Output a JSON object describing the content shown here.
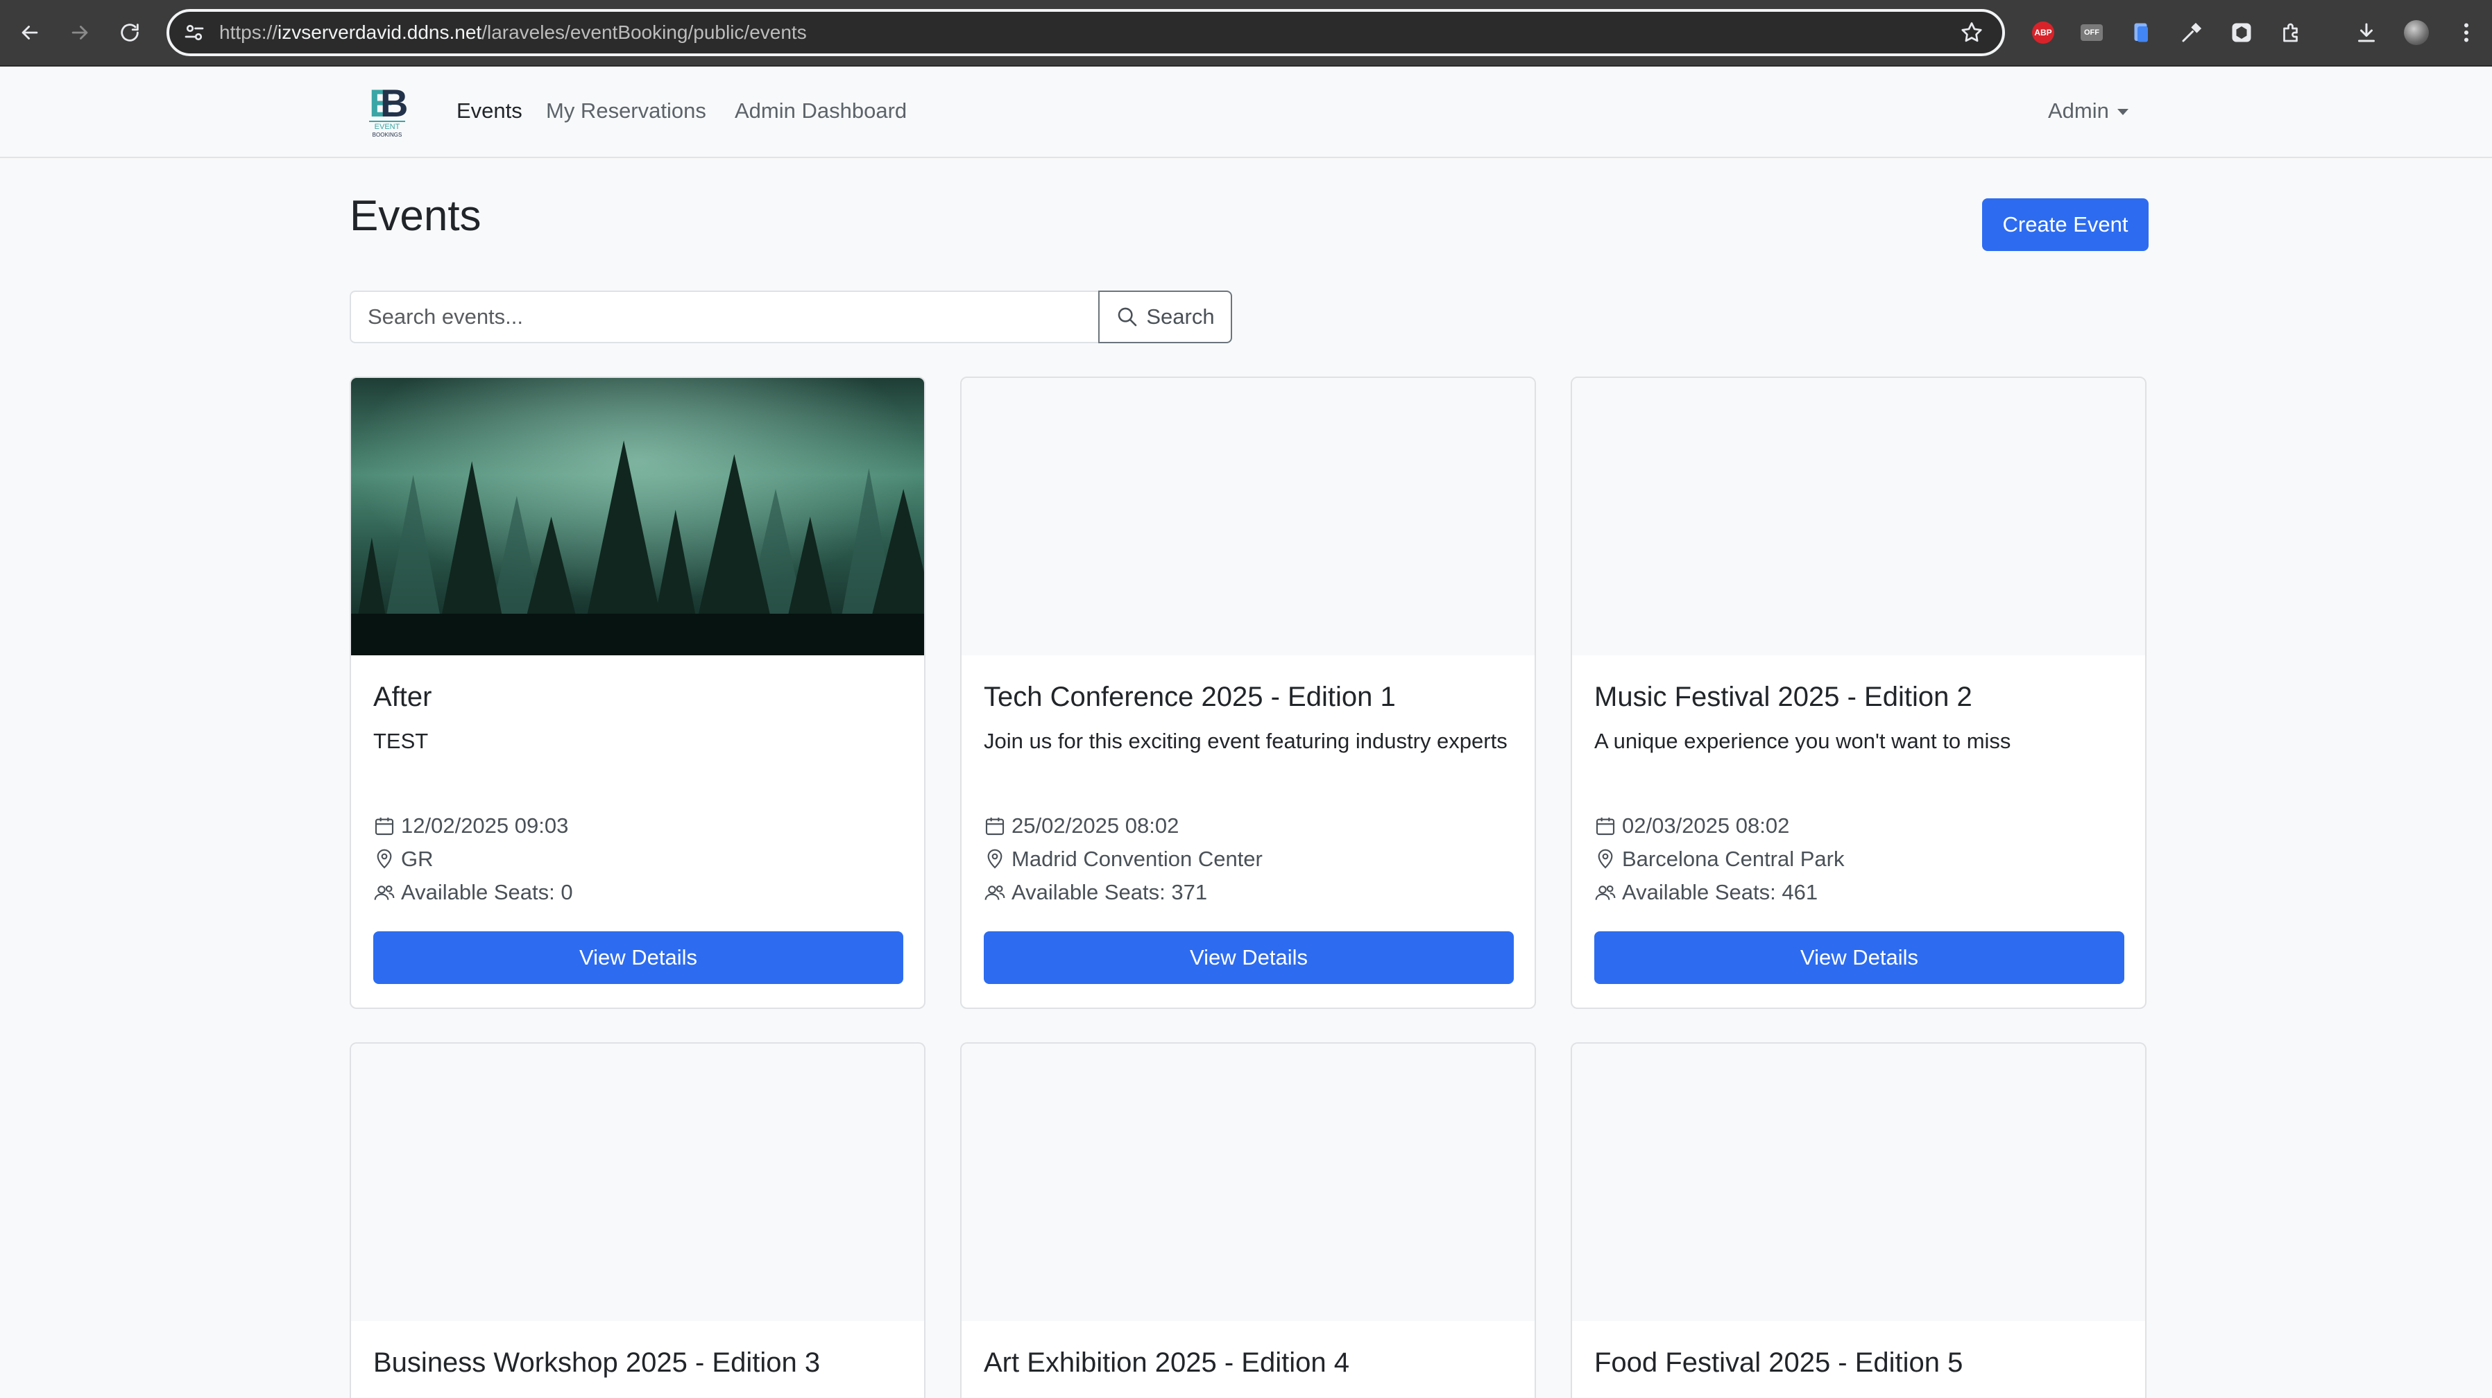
{
  "browser": {
    "url_prefix": "https://",
    "url_host": "izvserverdavid.ddns.net",
    "url_path": "/laraveles/eventBooking/public/events",
    "ext_abp": "ABP",
    "ext_off": "OFF"
  },
  "navbar": {
    "brand_alt": "Event Bookings",
    "links": [
      {
        "label": "Events"
      },
      {
        "label": "My Reservations"
      },
      {
        "label": "Admin Dashboard"
      }
    ],
    "user_menu": "Admin"
  },
  "page": {
    "title": "Events",
    "create_button": "Create Event"
  },
  "search": {
    "placeholder": "Search events...",
    "button": "Search"
  },
  "events": [
    {
      "title": "After",
      "description": "TEST",
      "date": "12/02/2025 09:03",
      "location": "GR",
      "seats": "Available Seats: 0",
      "button": "View Details",
      "has_image": true
    },
    {
      "title": "Tech Conference 2025 - Edition 1",
      "description": "Join us for this exciting event featuring industry experts",
      "date": "25/02/2025 08:02",
      "location": "Madrid Convention Center",
      "seats": "Available Seats: 371",
      "button": "View Details",
      "has_image": false
    },
    {
      "title": "Music Festival 2025 - Edition 2",
      "description": "A unique experience you won't want to miss",
      "date": "02/03/2025 08:02",
      "location": "Barcelona Central Park",
      "seats": "Available Seats: 461",
      "button": "View Details",
      "has_image": false
    },
    {
      "title": "Business Workshop 2025 - Edition 3"
    },
    {
      "title": "Art Exhibition 2025 - Edition 4"
    },
    {
      "title": "Food Festival 2025 - Edition 5"
    }
  ],
  "colors": {
    "primary": "#2d6cf0",
    "page_bg": "#f8f9fa",
    "card_border": "#dfe1e4"
  }
}
